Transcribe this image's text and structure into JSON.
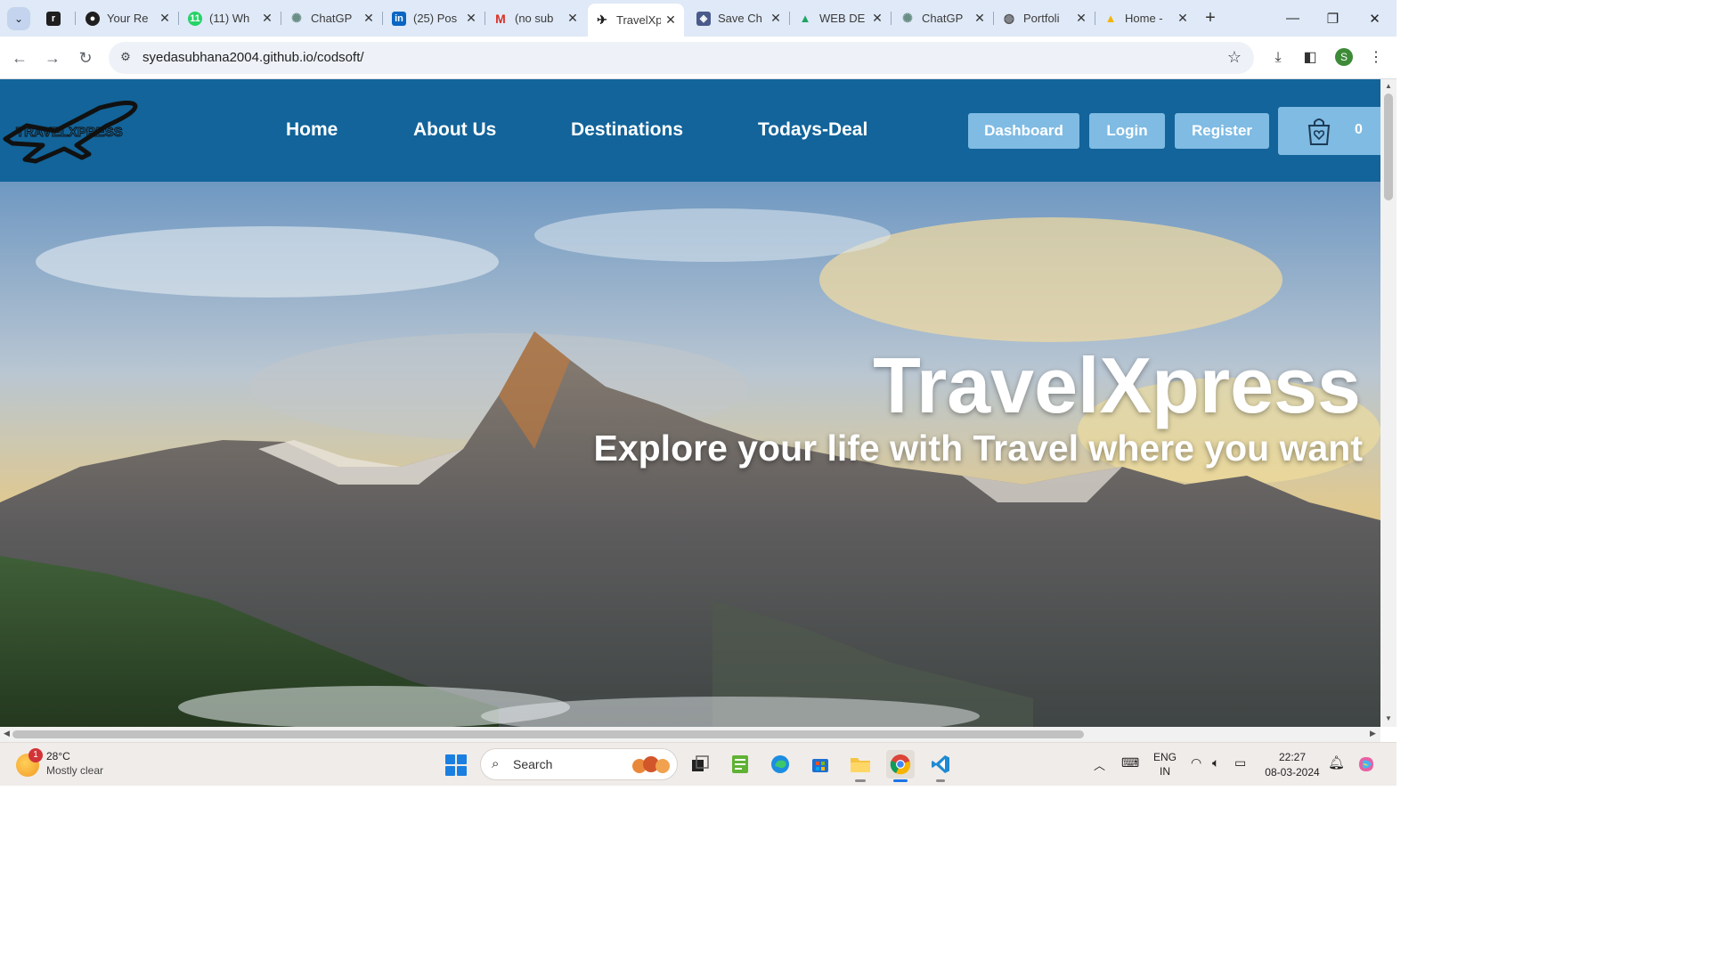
{
  "browser": {
    "tabs": [
      {
        "label": "",
        "icon": "dashboard-icon"
      },
      {
        "label": "Your Re",
        "icon": "github-icon"
      },
      {
        "label": "(11) Wh",
        "icon": "whatsapp-icon"
      },
      {
        "label": "ChatGP",
        "icon": "chatgpt-icon"
      },
      {
        "label": "(25) Pos",
        "icon": "linkedin-icon"
      },
      {
        "label": "(no sub",
        "icon": "gmail-icon"
      },
      {
        "label": "TravelXp",
        "icon": "plane-icon",
        "active": true
      },
      {
        "label": "Save Ch",
        "icon": "puzzle-icon"
      },
      {
        "label": "WEB DE",
        "icon": "drive-icon"
      },
      {
        "label": "ChatGP",
        "icon": "chatgpt-icon"
      },
      {
        "label": "Portfoli",
        "icon": "globe-icon"
      },
      {
        "label": "Home -",
        "icon": "drive-icon"
      }
    ],
    "url": "syedasubhana2004.github.io/codsoft/",
    "profile_initial": "S"
  },
  "site": {
    "nav": {
      "home": "Home",
      "about": "About Us",
      "destinations": "Destinations",
      "deals": "Todays-Deal"
    },
    "buttons": {
      "dashboard": "Dashboard",
      "login": "Login",
      "register": "Register"
    },
    "cart_count": "0",
    "logo_text": "TRAVELXPRESS",
    "hero": {
      "title": "TravelXpress",
      "subtitle": "Explore your life with Travel where you want"
    },
    "colors": {
      "header_bg": "#12649a",
      "button_bg": "#7fbbe3"
    }
  },
  "taskbar": {
    "weather": {
      "temp": "28°C",
      "desc": "Mostly clear",
      "badge": "1"
    },
    "search_placeholder": "Search",
    "lang": {
      "line1": "ENG",
      "line2": "IN"
    },
    "time": "22:27",
    "date": "08-03-2024"
  }
}
